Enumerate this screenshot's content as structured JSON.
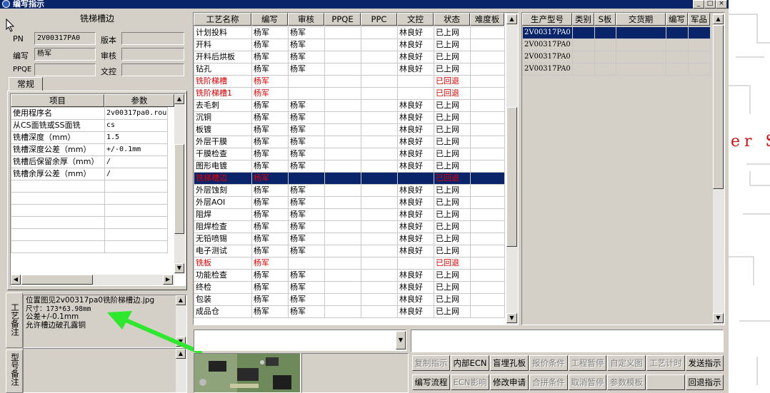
{
  "window": {
    "title": "编写指示",
    "min": "_",
    "max": "□",
    "close": "×"
  },
  "left": {
    "header": "铣梯槽边",
    "fields": [
      {
        "label": "PN",
        "value": "2V00317PA0"
      },
      {
        "label": "版本",
        "value": ""
      },
      {
        "label": "编写",
        "value": "杨军"
      },
      {
        "label": "审核",
        "value": ""
      },
      {
        "label": "PPQE",
        "value": ""
      },
      {
        "label": "文控",
        "value": ""
      }
    ],
    "tab": "常规",
    "param_headers": [
      "项目",
      "参数"
    ],
    "params": [
      [
        "使用程序名",
        "2v00317pa0.rou"
      ],
      [
        "从CS面铣或SS面铣",
        "cs"
      ],
      [
        "铣槽深度（mm）",
        "1.5"
      ],
      [
        "铣槽深度公差（mm）",
        "+/-0.1mm"
      ],
      [
        "铣槽后保留余厚（mm）",
        "/"
      ],
      [
        "铣槽余厚公差（mm）",
        "/"
      ]
    ],
    "remark_label": "工艺备注",
    "remark_lines": [
      "位置图见2v00317pa0铣阶梯槽边.jpg",
      "尺寸：173*63.98mm",
      "公差+/-0.1mm",
      "允许槽边破孔露铜"
    ],
    "model_remark_label": "型号备注"
  },
  "process": {
    "headers": [
      "工艺名称",
      "编写",
      "审核",
      "PPQE",
      "PPC",
      "文控",
      "状态",
      "难度板"
    ],
    "rows": [
      {
        "cells": [
          "计划投料",
          "杨军",
          "杨军",
          "",
          "",
          "林良好",
          "已上网",
          ""
        ],
        "style": ""
      },
      {
        "cells": [
          "开料",
          "杨军",
          "杨军",
          "",
          "",
          "林良好",
          "已上网",
          ""
        ],
        "style": ""
      },
      {
        "cells": [
          "开料后烘板",
          "杨军",
          "杨军",
          "",
          "",
          "林良好",
          "已上网",
          ""
        ],
        "style": ""
      },
      {
        "cells": [
          "钻孔",
          "杨军",
          "杨军",
          "",
          "",
          "林良好",
          "已上网",
          ""
        ],
        "style": ""
      },
      {
        "cells": [
          "铣阶梯槽",
          "杨军",
          "",
          "",
          "",
          "",
          "已回退",
          ""
        ],
        "style": "red"
      },
      {
        "cells": [
          "铣阶梯槽1",
          "杨军",
          "",
          "",
          "",
          "",
          "已回退",
          ""
        ],
        "style": "red"
      },
      {
        "cells": [
          "去毛刺",
          "杨军",
          "杨军",
          "",
          "",
          "林良好",
          "已上网",
          ""
        ],
        "style": ""
      },
      {
        "cells": [
          "沉铜",
          "杨军",
          "杨军",
          "",
          "",
          "林良好",
          "已上网",
          ""
        ],
        "style": ""
      },
      {
        "cells": [
          "板镀",
          "杨军",
          "杨军",
          "",
          "",
          "林良好",
          "已上网",
          ""
        ],
        "style": ""
      },
      {
        "cells": [
          "外层干膜",
          "杨军",
          "杨军",
          "",
          "",
          "林良好",
          "已上网",
          ""
        ],
        "style": ""
      },
      {
        "cells": [
          "干膜检查",
          "杨军",
          "杨军",
          "",
          "",
          "林良好",
          "已上网",
          ""
        ],
        "style": ""
      },
      {
        "cells": [
          "图形电镀",
          "杨军",
          "杨军",
          "",
          "",
          "林良好",
          "已上网",
          ""
        ],
        "style": ""
      },
      {
        "cells": [
          "铣梯槽边",
          "杨军",
          "",
          "",
          "",
          "",
          "已回退",
          ""
        ],
        "style": "sel"
      },
      {
        "cells": [
          "外层蚀刻",
          "杨军",
          "杨军",
          "",
          "",
          "林良好",
          "已上网",
          ""
        ],
        "style": ""
      },
      {
        "cells": [
          "外层AOI",
          "杨军",
          "杨军",
          "",
          "",
          "林良好",
          "已上网",
          ""
        ],
        "style": ""
      },
      {
        "cells": [
          "阻焊",
          "杨军",
          "杨军",
          "",
          "",
          "林良好",
          "已上网",
          ""
        ],
        "style": ""
      },
      {
        "cells": [
          "阻焊检查",
          "杨军",
          "杨军",
          "",
          "",
          "林良好",
          "已上网",
          ""
        ],
        "style": ""
      },
      {
        "cells": [
          "无铅喷锡",
          "杨军",
          "杨军",
          "",
          "",
          "林良好",
          "已上网",
          ""
        ],
        "style": ""
      },
      {
        "cells": [
          "电子测试",
          "杨军",
          "杨军",
          "",
          "",
          "林良好",
          "已上网",
          ""
        ],
        "style": ""
      },
      {
        "cells": [
          "铣板",
          "杨军",
          "",
          "",
          "",
          "",
          "已回退",
          ""
        ],
        "style": "red"
      },
      {
        "cells": [
          "功能检查",
          "杨军",
          "杨军",
          "",
          "",
          "林良好",
          "已上网",
          ""
        ],
        "style": ""
      },
      {
        "cells": [
          "终检",
          "杨军",
          "杨军",
          "",
          "",
          "林良好",
          "已上网",
          ""
        ],
        "style": ""
      },
      {
        "cells": [
          "包装",
          "杨军",
          "杨军",
          "",
          "",
          "林良好",
          "已上网",
          ""
        ],
        "style": ""
      },
      {
        "cells": [
          "成品仓",
          "杨军",
          "杨军",
          "",
          "",
          "林良好",
          "已上网",
          ""
        ],
        "style": ""
      }
    ]
  },
  "models": {
    "headers": [
      "生产型号",
      "类别",
      "S板",
      "交货期",
      "编写",
      "军品"
    ],
    "rows": [
      [
        "2V00317PA0"
      ],
      [
        "2V00317PA0"
      ],
      [
        "2V00317PA0"
      ],
      [
        "2V00317PA0"
      ]
    ]
  },
  "buttons": {
    "row1": [
      {
        "label": "复制指示",
        "enabled": false
      },
      {
        "label": "内部ECN",
        "enabled": true
      },
      {
        "label": "盲埋孔板",
        "enabled": true
      },
      {
        "label": "报价条件",
        "enabled": false
      },
      {
        "label": "工程暂停",
        "enabled": false
      },
      {
        "label": "自定义图",
        "enabled": false
      },
      {
        "label": "工艺计时",
        "enabled": false
      },
      {
        "label": "发送指示",
        "enabled": true
      }
    ],
    "row2": [
      {
        "label": "编写流程",
        "enabled": true
      },
      {
        "label": "ECN影响",
        "enabled": false
      },
      {
        "label": "修改申请",
        "enabled": true
      },
      {
        "label": "合拼条件",
        "enabled": false
      },
      {
        "label": "取消暂停",
        "enabled": false
      },
      {
        "label": "参数模板",
        "enabled": false
      },
      {
        "label": "",
        "enabled": false
      },
      {
        "label": "回退指示",
        "enabled": true
      }
    ]
  },
  "colors": {
    "selection": "#0a246a",
    "alert_text": "#e00000",
    "annotation_arrow": "#2ee82e",
    "title_bar": "#0a246a"
  },
  "background": {
    "red_text": "er S"
  }
}
